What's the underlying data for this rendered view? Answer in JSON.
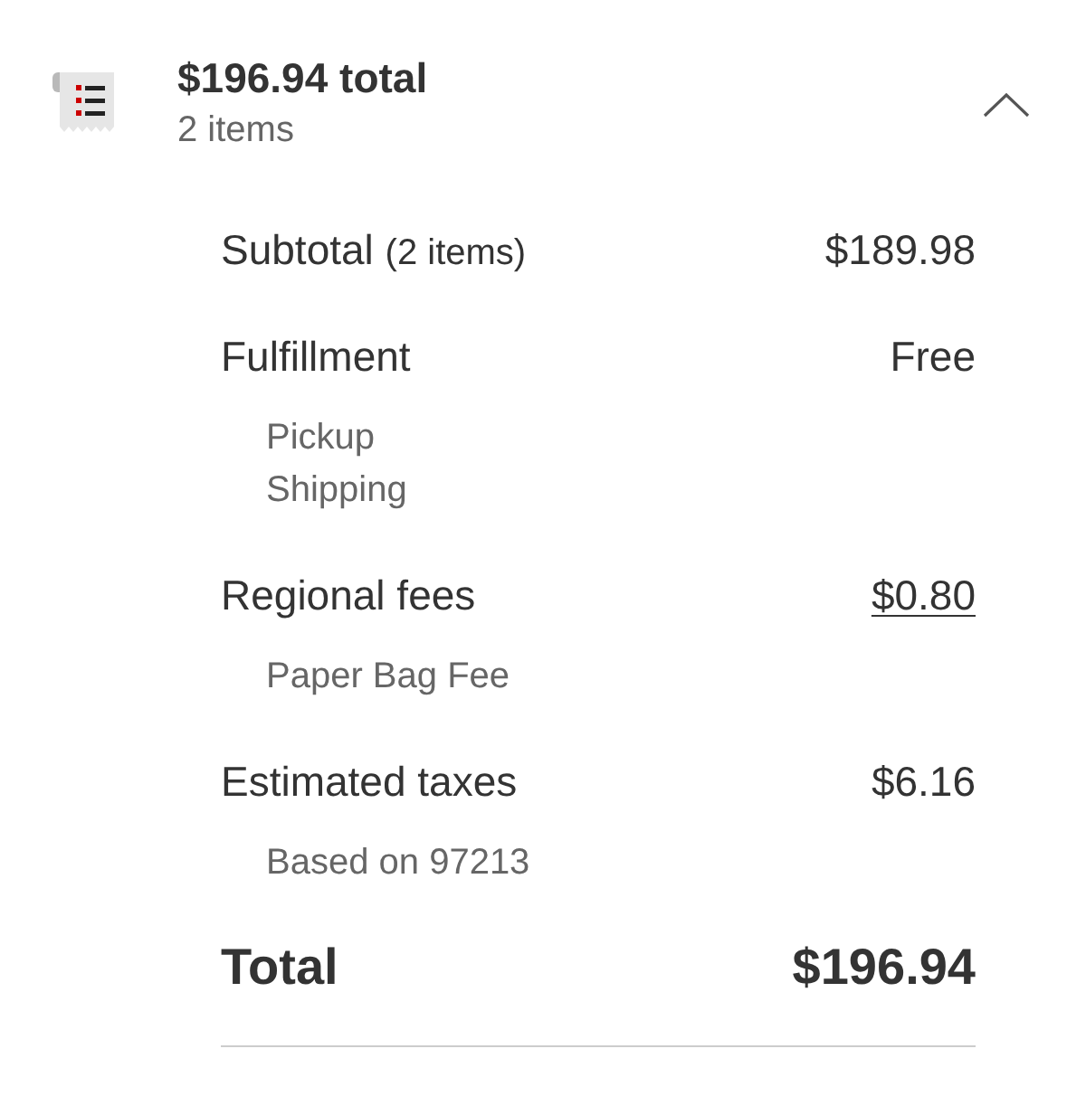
{
  "summary": {
    "title": "$196.94 total",
    "subtitle": "2 items",
    "expanded": true
  },
  "lines": [
    {
      "kind": "line",
      "label": "Subtotal",
      "note": "(2 items)",
      "value": "$189.98",
      "link": false
    },
    {
      "kind": "line",
      "label": "Fulfillment",
      "value": "Free",
      "link": false,
      "details": [
        "Pickup",
        "Shipping"
      ]
    },
    {
      "kind": "line",
      "label": "Regional fees",
      "value": "$0.80",
      "link": true,
      "details": [
        "Paper Bag Fee"
      ]
    },
    {
      "kind": "line",
      "label": "Estimated taxes",
      "value": "$6.16",
      "link": false,
      "details": [
        "Based on 97213"
      ]
    },
    {
      "kind": "total",
      "label": "Total",
      "value": "$196.94",
      "link": false
    }
  ]
}
